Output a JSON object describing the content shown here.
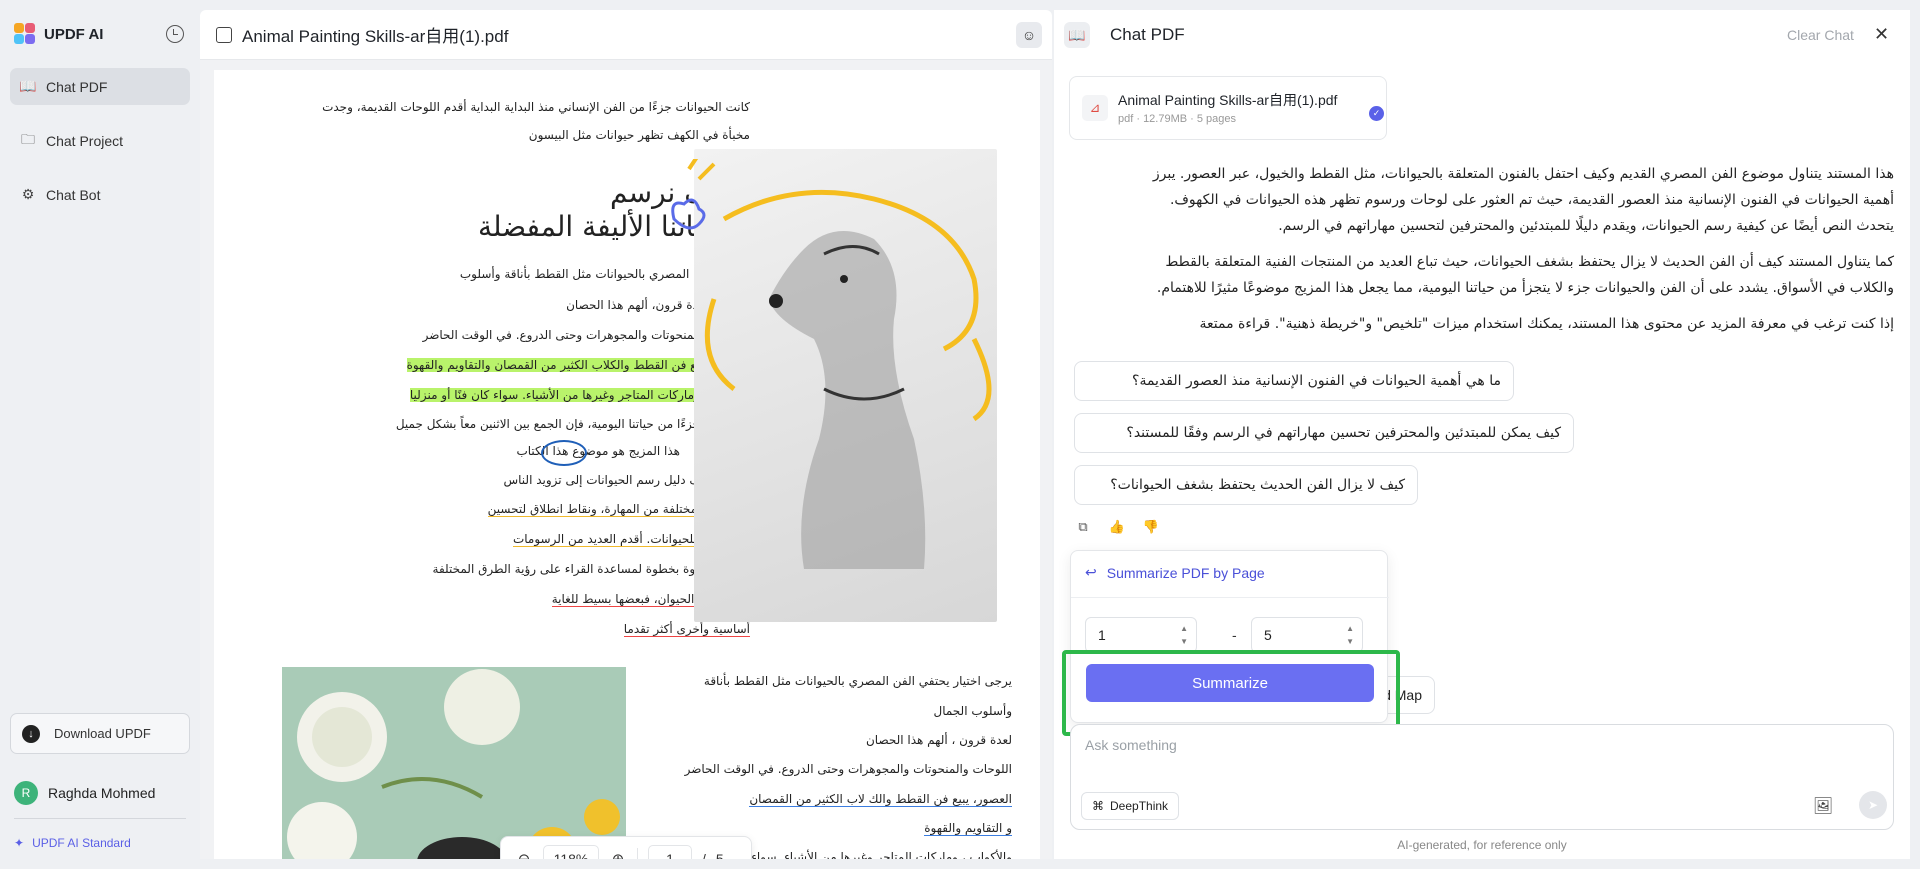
{
  "sidebar": {
    "brand": "UPDF AI",
    "items": [
      {
        "label": "Chat PDF"
      },
      {
        "label": "Chat Project"
      },
      {
        "label": "Chat Bot"
      }
    ],
    "download_label": "Download UPDF",
    "user": {
      "initial": "R",
      "name": "Raghda Mohmed"
    },
    "plan": "UPDF AI Standard"
  },
  "pdf": {
    "title": "Animal Painting Skills-ar自用(1).pdf",
    "lines_top": [
      "كانت الحيوانات جزءًا من الفن الإنساني منذ البداية البداية أقدم اللوحات القديمة، وجدت",
      "مخبأة في الكهف تظهر حيوانات مثل البيسون"
    ],
    "heading": [
      "كيف نرسم",
      "حيواناتنا الأليفة المفضلة"
    ],
    "lines_mid": [
      "يحتفي الفن المصري بالحيوانات مثل القطط بأناقة وأسلوب",
      "الجمال. لعدة قرون، ألهم هذا الحصان",
      "اللوحات والمنحوتات والمجوهرات وحتى الدروع. في الوقت الحاضر",
      "العصور، يبيع فن القطط والكلاب الكثير من القمصان والتقاويم والقهوة",
      "والأكواب، وماركات المتاجر وغيرها من الأشياء. سواء كان فنًا أو منزليا",
      "الحيوانات جزءًا من حياتنا اليومية، فإن الجمع بين الاثنين معاً بشكل جميل",
      "هذا المزيج هو موضوع هذا الكتاب",
      "الفنان يهدف دليل رسم الحيوانات إلى تزويد الناس",
      "بمستويات مختلفة من المهارة، ونقاط انطلاق لتحسين",
      "رسوماتهم للحيوانات. أقدم العديد من الرسومات",
      "و أمثلة خطوة بخطوة لمساعدة القراء على رؤية الطرق المختلفة",
      "بناء تشريح الحيوان، فبعضها بسيط للغاية",
      "أساسية وأخرى أكثر تقدما"
    ],
    "lines_bottom": [
      "يرجى اختيار يحتفي الفن المصري بالحيوانات مثل القطط بأناقة",
      "وأسلوب الجمال",
      "لعدة قرون ، ألهم هذا الحصان",
      "اللوحات والمنحوتات والمجوهرات وحتى الدروع. في الوقت الحاضر",
      "العصور، يبيع فن القطط والك  لاب الكثير من القمصان",
      "و التقاويم والقهوة",
      "والأكواب ، وماركات المتاجر وغيرها من الأشياء. سواء كان فنًا أو منزليا"
    ],
    "zoom": {
      "value": "118%",
      "page": "1",
      "total": "5",
      "sep": "/"
    }
  },
  "chat": {
    "title": "Chat PDF",
    "clear_label": "Clear Chat",
    "file": {
      "name": "Animal Painting Skills-ar自用(1).pdf",
      "meta": "pdf · 12.79MB · 5 pages"
    },
    "answer": [
      "هذا المستند يتناول موضوع الفن المصري القديم وكيف احتفل بالفنون المتعلقة بالحيوانات، مثل القطط والخيول، عبر العصور. يبرز",
      "أهمية الحيوانات في الفنون الإنسانية منذ العصور القديمة، حيث تم العثور على لوحات ورسوم تظهر هذه الحيوانات في الكهوف.",
      "يتحدث النص أيضًا عن كيفية رسم الحيوانات، ويقدم دليلًا للمبتدئين والمحترفين لتحسين مهاراتهم في الرسم.",
      "كما يتناول المستند كيف أن الفن الحديث لا يزال يحتفظ بشغف الحيوانات، حيث تباع العديد من المنتجات الفنية المتعلقة بالقطط",
      "والكلاب في الأسواق. يشدد على أن الفن والحيوانات جزء لا يتجزأ من حياتنا اليومية، مما يجعل هذا المزيج موضوعًا مثيرًا للاهتمام.",
      "إذا كنت ترغب في معرفة المزيد عن محتوى هذا المستند، يمكنك استخدام ميزات \"تلخيص\" و\"خريطة ذهنية\". قراءة ممتعة"
    ],
    "suggestions": [
      "ما هي أهمية الحيوانات في الفنون الإنسانية منذ العصور القديمة؟",
      "كيف يمكن للمبتدئين والمحترفين تحسين مهاراتهم في الرسم وفقًا للمستند؟",
      "كيف لا يزال الفن الحديث يحتفظ بشغف الحيوانات؟"
    ],
    "mind_map_label": "d Map",
    "popover": {
      "title": "Summarize PDF by Page",
      "from": "1",
      "to": "5",
      "dash": "-",
      "button": "Summarize"
    },
    "input_placeholder": "Ask something",
    "deepthink_label": "DeepThink",
    "disclaimer": "AI-generated, for reference only"
  },
  "colors": {
    "accent": "#6a6ff2",
    "highlight_frame": "#2db84a",
    "text_highlight": "#b9f36b"
  }
}
